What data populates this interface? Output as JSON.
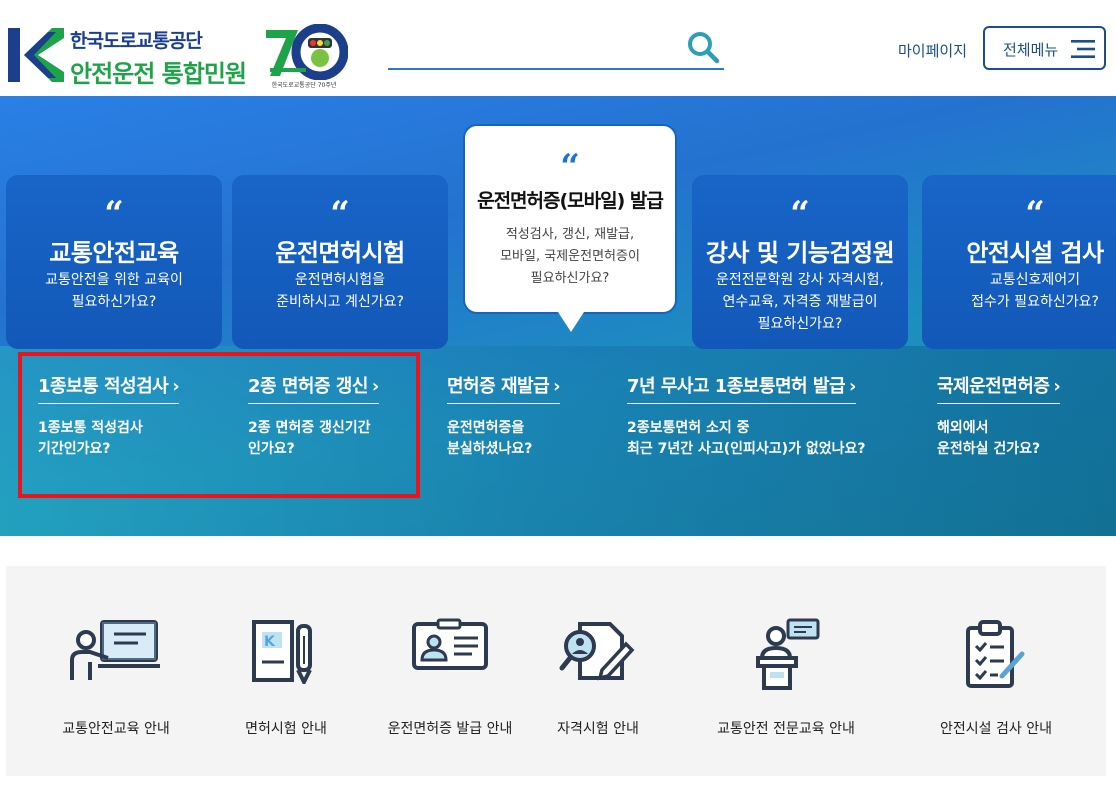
{
  "header": {
    "logo_line1": "한국도로교통공단",
    "logo_line2": "안전운전 통합민원",
    "anniversary_caption": "한국도로교통공단 70주년",
    "search_placeholder": "",
    "mypage_label": "마이페이지",
    "allmenu_label": "전체메뉴"
  },
  "hero": {
    "quote_mark": "“",
    "cards": [
      {
        "title": "교통안전교육",
        "desc": "교통안전을 위한 교육이\n필요하신가요?"
      },
      {
        "title": "운전면허시험",
        "desc": "운전면허시험을\n준비하시고 계신가요?"
      },
      {
        "title": "강사 및 기능검정원",
        "desc": "운전전문학원 강사 자격시험,\n연수교육, 자격증 재발급이\n필요하신가요?"
      },
      {
        "title": "안전시설 검사",
        "desc": "교통신호제어기\n접수가 필요하신가요?"
      }
    ],
    "featured": {
      "title": "운전면허증(모바일) 발급",
      "desc": "적성검사, 갱신, 재발급,\n모바일, 국제운전면허증이\n필요하신가요?"
    },
    "quick_links": [
      {
        "title": "1종보통 적성검사",
        "desc": "1종보통 적성검사\n기간인가요?"
      },
      {
        "title": "2종 면허증 갱신",
        "desc": "2종 면허증 갱신기간\n인가요?"
      },
      {
        "title": "면허증 재발급",
        "desc": "운전면허증을\n분실하셨나요?"
      },
      {
        "title": "7년 무사고 1종보통면허 발급",
        "desc": "2종보통면허 소지 중\n최근 7년간 사고(인피사고)가 없었나요?"
      },
      {
        "title": "국제운전면허증",
        "desc": "해외에서\n운전하실 건가요?"
      }
    ],
    "arrow": "›"
  },
  "services": [
    {
      "label": "교통안전교육 안내",
      "icon": "presentation-board-icon"
    },
    {
      "label": "면허시험 안내",
      "icon": "license-document-pen-icon"
    },
    {
      "label": "운전면허증 발급 안내",
      "icon": "id-card-icon"
    },
    {
      "label": "자격시험 안내",
      "icon": "exam-magnifier-icon"
    },
    {
      "label": "교통안전 전문교육 안내",
      "icon": "lecturer-podium-icon"
    },
    {
      "label": "안전시설 검사 안내",
      "icon": "checklist-clipboard-icon"
    }
  ],
  "colors": {
    "brand_blue": "#1b3f8a",
    "brand_green": "#1ea34a",
    "hero_blue": "#2472d0",
    "card_blue": "#1565c0",
    "highlight_red": "#e8161c"
  }
}
